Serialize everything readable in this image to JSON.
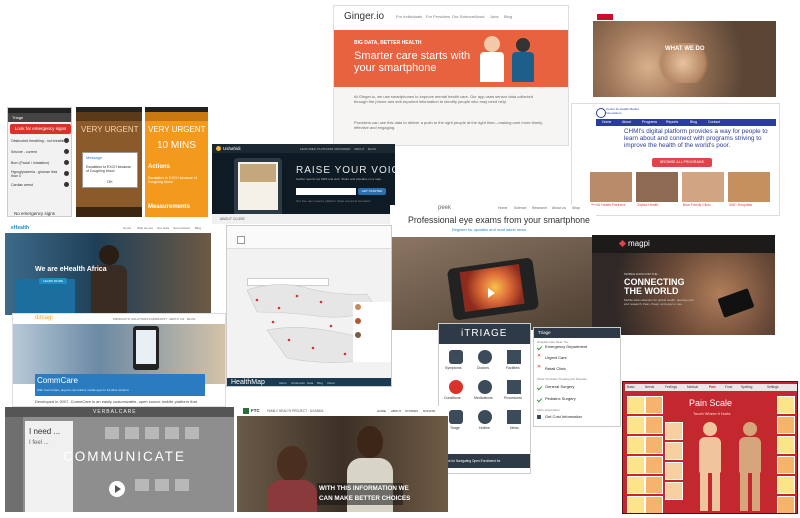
{
  "ginger": {
    "logo": "Ginger.io",
    "nav": [
      "For Individuals",
      "For Providers",
      "Our Science",
      "About",
      "Jobs",
      "Blog"
    ],
    "kicker": "BIG DATA, BETTER HEALTH",
    "headline": "Smarter care starts with your smartphone",
    "para1": "At Ginger.io, we use smartphones to improve mental health care. Our app uses sensor data collected through the phone and self-reported information to identify people who may need help.",
    "para2": "Providers can use this data to deliver a push to the right people at the right time—making care more timely, effective and engaging."
  },
  "charity": {
    "banner": "WHAT WE DO"
  },
  "triage_app": {
    "panel1_bar": "Triage",
    "emergency_button": "Look for emergency signs",
    "rows": [
      "Obstructed breathing - not breathing",
      "Seizure - current",
      "Burn (Facial / Inhalation)",
      "Hypoglycaemia - glucose less than 3",
      "Cardiac arrest"
    ],
    "no_emergency": "No emergency signs",
    "panel2_title": "VERY URGENT",
    "panel2_dialog_title": "Message",
    "panel2_dialog_text": "Escalation to EXCH because of Coughing blood",
    "panel2_dialog_ok": "OK",
    "panel3_title": "VERY URGENT",
    "panel3_time": "10 MINS",
    "actions_label": "Actions",
    "actions_text": "Escalation to EXCH because of Coughing blood",
    "measurements_label": "Measurements"
  },
  "chmi": {
    "logo": "Center for Health Market Innovations",
    "nav": [
      "Home",
      "About",
      "Programs",
      "Reports",
      "Blog",
      "Contact"
    ],
    "tagline": "CHMI's digital platform provides a way for people to learn about and connect with programs striving to improve the health of the world's poor.",
    "cta": "BROWSE ALL PROGRAMS",
    "cards": [
      "World Health Partners",
      "Ziqitza Health",
      "Blue Family Clinic",
      "SMC Hospitals"
    ]
  },
  "ushahidi": {
    "logo": "Ushahidi",
    "nav": [
      "FEATURES",
      "PLATFORM",
      "CRISISMAP",
      "ABOUT",
      "BLOG"
    ],
    "headline": "RAISE YOUR VOICE",
    "subtitle": "Gather reports via SMS and web. Share and visualize on a map.",
    "signup": "GET STARTED",
    "bottom": "ABOUT CLOSE",
    "footnote": "Our free open source platform helps everyone be heard."
  },
  "peek": {
    "logo": "peek",
    "nav": [
      "Home",
      "Science",
      "Research",
      "About us",
      "Shop"
    ],
    "headline": "Professional eye exams from your smartphone",
    "sub": "Register for updates and read latest news"
  },
  "ehealth": {
    "logo": "eHealth",
    "nav": [
      "Home",
      "Who we are",
      "Our work",
      "Get involved",
      "Blog"
    ],
    "banner": "We are eHealth Africa",
    "button": "LEARN MORE"
  },
  "healthmap": {
    "logo": "HealthMap",
    "search": "",
    "footer": [
      "Alerts",
      "Outbreaks",
      "Data",
      "Blog",
      "About"
    ]
  },
  "magpi": {
    "logo": "magpi",
    "small": "MOBILE DATA FOR THE",
    "headline": "CONNECTING THE WORLD",
    "text": "Mobile data collection for global health, development and research. Fast, cheap, and easy to use."
  },
  "commcare": {
    "logo": "dimagi",
    "nav": [
      "PRODUCTS",
      "SOLUTIONS",
      "COMMUNITY",
      "ABOUT US",
      "BLOG"
    ],
    "banner": "CommCare",
    "banner_sub": "With CommCare, anyone can build a mobile app for frontline workers",
    "footer": "Developed in 2007, CommCare is an easily customizable, open source mobile platform that"
  },
  "itriage": {
    "logo": "iTRIAGE",
    "icons": [
      "Symptoms",
      "Doctors",
      "Facilities",
      "Conditions",
      "Medications",
      "Procedures",
      "Triage",
      "Hotline",
      "News"
    ],
    "ad": "5 Tips for Navigating Open Enrollment for",
    "list_header": "Triage",
    "list_section1": "Hospital Care Near You",
    "list_items": [
      "Emergency Department",
      "Urgent Care",
      "Retail Clinic"
    ],
    "list_section2": "Other Providers Treating this Disease",
    "list_items2": [
      "General Surgery",
      "Pediatric Surgery"
    ],
    "list_section3": "More Information",
    "list_items3": [
      "Get Cost Information"
    ]
  },
  "verbalcare": {
    "logo": "VERBALCARE",
    "left_text": "I need ...",
    "left_sub": "I feel ...",
    "headline": "COMMUNICATE"
  },
  "pain": {
    "tabs": [
      "Basic",
      "Needs",
      "Feelings",
      "Medical",
      "Pain",
      "Food",
      "Spelling",
      "Settings"
    ],
    "title": "Pain Scale",
    "subtitle": "Touch Where it Hurts"
  },
  "ftc": {
    "logo": "FTC",
    "org": "FAMILY HEALTH PROJECT · UGANDA",
    "nav": [
      "HOME",
      "ABOUT",
      "STORIES",
      "DONATE"
    ],
    "caption_line1": "WITH THIS INFORMATION WE",
    "caption_line2": "CAN MAKE BETTER CHOICES"
  },
  "colors": {
    "ginger_orange": "#e8623f",
    "triage_red": "#d9322b",
    "triage_brown": "#8b5a2b",
    "triage_orange": "#f39a1c",
    "chmi_blue": "#2b3d9a",
    "chmi_red": "#e2434a",
    "ehealth_blue": "#1e8cc4",
    "commcare_blue": "#2b7bc1",
    "pain_red": "#c3282e"
  }
}
